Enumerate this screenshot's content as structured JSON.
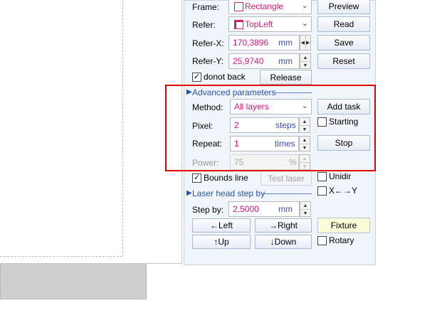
{
  "frame": {
    "label": "Frame:",
    "value": "Rectangle"
  },
  "refer": {
    "label": "Refer:",
    "value": "TopLeft"
  },
  "refer_x": {
    "label": "Refer-X:",
    "value": "170,3896",
    "unit": "mm"
  },
  "refer_y": {
    "label": "Refer-Y:",
    "value": "25,9740",
    "unit": "mm"
  },
  "buttons": {
    "preview": "Preview",
    "read": "Read",
    "save": "Save",
    "reset": "Reset",
    "release": "Release",
    "add_task": "Add task",
    "stop": "Stop",
    "test_laser": "Test laser",
    "left": "←Left",
    "right": "→Right",
    "up": "↑Up",
    "down": "↓Down",
    "fixture": "Fixture"
  },
  "donot_back": {
    "label": "donot back",
    "checked": true
  },
  "advanced": {
    "title": "Advanced parameters"
  },
  "method": {
    "label": "Method:",
    "value": "All layers"
  },
  "starting": {
    "label": "Starting",
    "checked": false
  },
  "pixel": {
    "label": "Pixel:",
    "value": "2",
    "unit": "steps"
  },
  "repeat": {
    "label": "Repeat:",
    "value": "1",
    "unit": "times"
  },
  "power": {
    "label": "Power:",
    "value": "75",
    "unit": "%"
  },
  "bounds_line": {
    "label": "Bounds line",
    "checked": true
  },
  "unidir": {
    "label": "Unidir",
    "checked": false
  },
  "x_swap": {
    "label": "X←→Y",
    "checked": false
  },
  "laser_head": {
    "title": "Laser head step by"
  },
  "step_by": {
    "label": "Step by:",
    "value": "2,5000",
    "unit": "mm"
  },
  "rotary": {
    "label": "Rotary",
    "checked": false
  },
  "colors": {
    "highlight": "#e00000",
    "value_text": "#d6187a",
    "unit_text": "#3a4fb0",
    "section_text": "#2952a8",
    "panel_bg": "#f0f4fb"
  }
}
